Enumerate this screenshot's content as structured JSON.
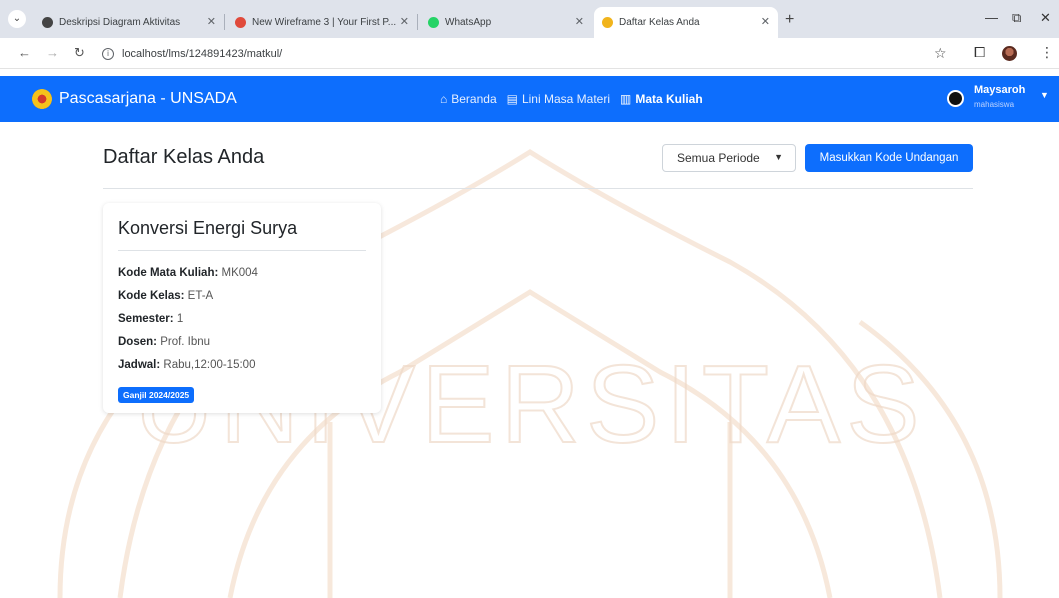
{
  "browser": {
    "tabs": [
      {
        "label": "Deskripsi Diagram Aktivitas",
        "favicon_color": "#444444"
      },
      {
        "label": "New Wireframe 3 | Your First P...",
        "favicon_color": "#e04a3b"
      },
      {
        "label": "WhatsApp",
        "favicon_color": "#25d366"
      },
      {
        "label": "Daftar Kelas Anda",
        "favicon_color": "#f1b41c"
      }
    ],
    "url": "localhost/lms/124891423/matkul/"
  },
  "navbar": {
    "brand": "Pascasarjana - UNSADA",
    "links": [
      {
        "label": "Beranda",
        "icon": "home-icon"
      },
      {
        "label": "Lini Masa Materi",
        "icon": "timeline-icon"
      },
      {
        "label": "Mata Kuliah",
        "icon": "book-icon"
      }
    ],
    "user_name": "Maysaroh",
    "user_role": "mahasiswa"
  },
  "page": {
    "title": "Daftar Kelas Anda",
    "period_filter": "Semua Periode",
    "invite_button": "Masukkan Kode Undangan"
  },
  "course": {
    "title": "Konversi Energi Surya",
    "fields": [
      {
        "label": "Kode Mata Kuliah:",
        "value": "MK004"
      },
      {
        "label": "Kode Kelas:",
        "value": "ET-A"
      },
      {
        "label": "Semester:",
        "value": "1"
      },
      {
        "label": "Dosen:",
        "value": "Prof. Ibnu"
      },
      {
        "label": "Jadwal:",
        "value": "Rabu,12:00-15:00"
      }
    ],
    "badge": "Ganjil 2024/2025"
  },
  "watermark": {
    "text": "UNIVERSITAS"
  },
  "colors": {
    "primary": "#0d6efd",
    "tabbar": "#dfe3eb"
  }
}
